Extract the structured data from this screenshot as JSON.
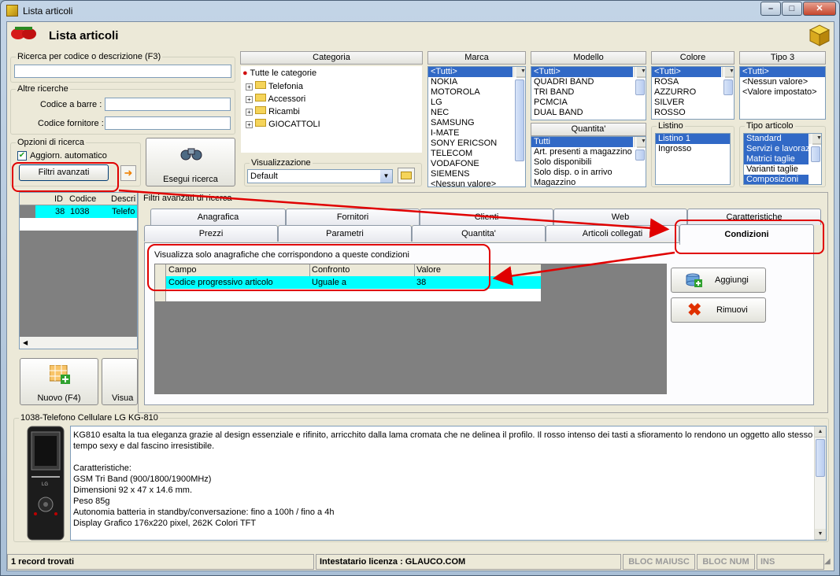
{
  "window": {
    "title": "Lista articoli"
  },
  "header": {
    "title": "Lista articoli"
  },
  "search": {
    "group_label": "Ricerca per codice o descrizione (F3)",
    "value": ""
  },
  "other_search": {
    "group_label": "Altre ricerche",
    "barcode_label": "Codice a barre :",
    "supplier_code_label": "Codice fornitore :"
  },
  "options": {
    "group_label": "Opzioni di ricerca",
    "auto_update_label": "Aggiorn. automatico",
    "auto_update_checked": true,
    "advanced_filters_label": "Filtri avanzati"
  },
  "execute_button": "Esegui ricerca",
  "category": {
    "header": "Categoria",
    "items": [
      "Tutte le categorie",
      "Telefonia",
      "Accessori",
      "Ricambi",
      "GIOCATTOLI"
    ],
    "view_label": "Visualizzazione",
    "view_value": "Default"
  },
  "marca": {
    "header": "Marca",
    "items": [
      "<Tutti>",
      "NOKIA",
      "MOTOROLA",
      "LG",
      "NEC",
      "SAMSUNG",
      "I-MATE",
      "SONY ERICSON",
      "TELECOM",
      "VODAFONE",
      "SIEMENS",
      "<Nessun valore>"
    ]
  },
  "modello": {
    "header": "Modello",
    "items": [
      "<Tutti>",
      "QUADRI BAND",
      "TRI BAND",
      "PCMCIA",
      "DUAL BAND"
    ]
  },
  "colore": {
    "header": "Colore",
    "items": [
      "<Tutti>",
      "ROSA",
      "AZZURRO",
      "SILVER",
      "ROSSO"
    ]
  },
  "tipo3": {
    "header": "Tipo 3",
    "items": [
      "<Tutti>",
      "<Nessun valore>",
      "<Valore impostato>"
    ]
  },
  "quantita": {
    "header": "Quantita'",
    "items": [
      "Tutti",
      "Art. presenti a magazzino",
      "Solo disponibili",
      "Solo disp. o in arrivo",
      "Magazzino"
    ]
  },
  "listino": {
    "header": "Listino",
    "items": [
      "Listino 1",
      "Ingrosso"
    ]
  },
  "tipo_articolo": {
    "header": "Tipo articolo",
    "items": [
      "Standard",
      "Servizi e lavoraz",
      "Matrici taglie",
      "Varianti taglie",
      "Composizioni"
    ]
  },
  "grid": {
    "columns": [
      "ID",
      "Codice",
      "Descri"
    ],
    "rows": [
      [
        "38",
        "1038",
        "Telefo"
      ]
    ]
  },
  "bottom_buttons": {
    "new": "Nuovo (F4)",
    "view": "Visua"
  },
  "filters_panel": {
    "title": "Filtri avanzati di ricerca",
    "tabs_back": [
      "Anagrafica",
      "Fornitori",
      "Clienti",
      "Web",
      "Caratteristiche"
    ],
    "tabs_front": [
      "Prezzi",
      "Parametri",
      "Quantita'",
      "Articoli collegati",
      "Condizioni"
    ],
    "active_tab": "Condizioni",
    "instruction": "Visualizza solo anagrafiche che corrispondono a queste condizioni",
    "columns": [
      "Campo",
      "Confronto",
      "Valore"
    ],
    "rows": [
      [
        "Codice progressivo articolo",
        "Uguale a",
        "38"
      ]
    ],
    "add_button": "Aggiungi",
    "remove_button": "Rimuovi"
  },
  "details": {
    "group_label": "1038-Telefono Cellulare LG KG-810",
    "lines": [
      "KG810 esalta la tua eleganza grazie al design essenziale e rifinito, arricchito dalla lama cromata che ne delinea il profilo. Il rosso intenso dei tasti a sfioramento lo rendono un oggetto allo stesso",
      "tempo sexy e dal fascino irresistibile.",
      "",
      "Caratteristiche:",
      "GSM Tri Band (900/1800/1900MHz)",
      "Dimensioni 92 x 47 x 14.6 mm.",
      "Peso 85g",
      "Autonomia batteria in standby/conversazione: fino a 100h / fino a 4h",
      "Display Grafico 176x220 pixel, 262K Colori TFT"
    ]
  },
  "status": {
    "records": "1 record trovati",
    "license": "Intestatario licenza : GLAUCO.COM",
    "caps": "BLOC MAIUSC",
    "num": "BLOC NUM",
    "ins": "INS"
  },
  "colors": {
    "accent": "#3169c6",
    "cyan_row": "#00ffff",
    "annotation": "#e00000"
  }
}
